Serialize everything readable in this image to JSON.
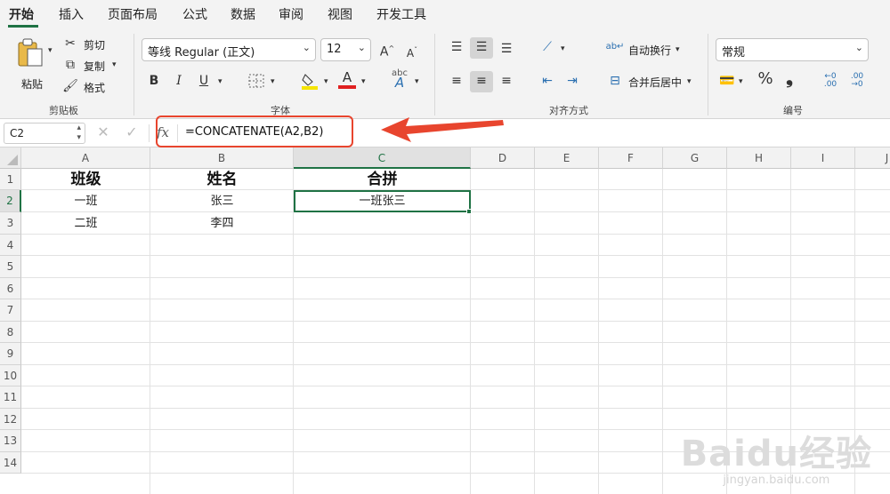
{
  "tabs": [
    "开始",
    "插入",
    "页面布局",
    "公式",
    "数据",
    "审阅",
    "视图",
    "开发工具"
  ],
  "clipboard": {
    "paste": "粘贴",
    "cut": "剪切",
    "copy": "复制",
    "format_painter": "格式",
    "group": "剪贴板"
  },
  "font": {
    "name": "等线 Regular (正文)",
    "size": "12",
    "group": "字体",
    "bold": "B",
    "italic": "I",
    "underline": "U",
    "font_color_swatch": "#e02020",
    "fill_color_swatch": "#f5e400"
  },
  "alignment": {
    "wrap": "自动换行",
    "merge": "合并后居中",
    "group": "对齐方式"
  },
  "number": {
    "format": "常规",
    "percent": "%",
    "comma": "❟",
    "group": "编号"
  },
  "formula_bar": {
    "name_box": "C2",
    "fx": "fx",
    "formula": "=CONCATENATE(A2,B2)"
  },
  "sheet": {
    "columns": [
      "A",
      "B",
      "C",
      "D",
      "E",
      "F",
      "G",
      "H",
      "I",
      "J"
    ],
    "rows": [
      "1",
      "2",
      "3",
      "4",
      "5",
      "6",
      "7",
      "8",
      "9",
      "10",
      "11",
      "12",
      "13",
      "14"
    ],
    "cells": {
      "A1": "班级",
      "B1": "姓名",
      "C1": "合拼",
      "A2": "一班",
      "B2": "张三",
      "C2": "一班张三",
      "A3": "二班",
      "B3": "李四"
    },
    "selected": "C2"
  },
  "watermark": {
    "text": "Baidu经验",
    "url": "jingyan.baidu.com"
  },
  "colors": {
    "accent": "#1f7244",
    "highlight": "#e8452e"
  }
}
